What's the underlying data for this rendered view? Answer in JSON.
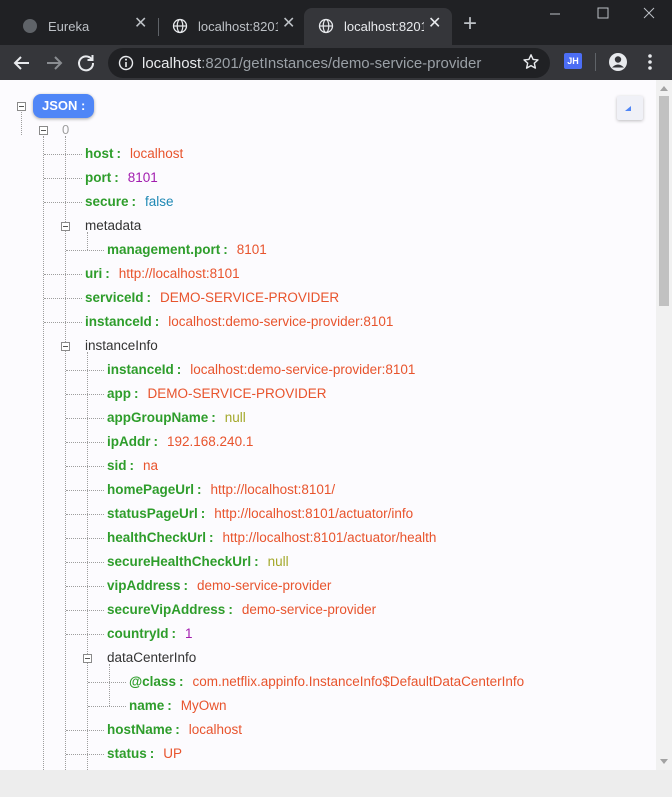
{
  "tabs": [
    {
      "title": "Eureka",
      "active": false,
      "icon": "globe-icon"
    },
    {
      "title": "localhost:8201",
      "active": false,
      "icon": "globe-icon"
    },
    {
      "title": "localhost:8201",
      "active": true,
      "icon": "globe-icon"
    }
  ],
  "toolbar": {
    "url_host": "localhost",
    "url_rest": ":8201/getInstances/demo-service-provider",
    "extension_label": "JH"
  },
  "json_view": {
    "root_label": "JSON :",
    "index_label": "0",
    "separator": ":",
    "rows": [
      {
        "key": "host",
        "value": "localhost",
        "type": "string"
      },
      {
        "key": "port",
        "value": "8101",
        "type": "number"
      },
      {
        "key": "secure",
        "value": "false",
        "type": "bool"
      },
      {
        "key": "metadata",
        "value": "",
        "type": "object"
      },
      {
        "key": "management.port",
        "value": "8101",
        "type": "string"
      },
      {
        "key": "uri",
        "value": "http://localhost:8101",
        "type": "string"
      },
      {
        "key": "serviceId",
        "value": "DEMO-SERVICE-PROVIDER",
        "type": "string"
      },
      {
        "key": "instanceId",
        "value": "localhost:demo-service-provider:8101",
        "type": "string"
      },
      {
        "key": "instanceInfo",
        "value": "",
        "type": "object"
      },
      {
        "key": "instanceId",
        "value": "localhost:demo-service-provider:8101",
        "type": "string"
      },
      {
        "key": "app",
        "value": "DEMO-SERVICE-PROVIDER",
        "type": "string"
      },
      {
        "key": "appGroupName",
        "value": "null",
        "type": "null"
      },
      {
        "key": "ipAddr",
        "value": "192.168.240.1",
        "type": "string"
      },
      {
        "key": "sid",
        "value": "na",
        "type": "string"
      },
      {
        "key": "homePageUrl",
        "value": "http://localhost:8101/",
        "type": "string"
      },
      {
        "key": "statusPageUrl",
        "value": "http://localhost:8101/actuator/info",
        "type": "string"
      },
      {
        "key": "healthCheckUrl",
        "value": "http://localhost:8101/actuator/health",
        "type": "string"
      },
      {
        "key": "secureHealthCheckUrl",
        "value": "null",
        "type": "null"
      },
      {
        "key": "vipAddress",
        "value": "demo-service-provider",
        "type": "string"
      },
      {
        "key": "secureVipAddress",
        "value": "demo-service-provider",
        "type": "string"
      },
      {
        "key": "countryId",
        "value": "1",
        "type": "number"
      },
      {
        "key": "dataCenterInfo",
        "value": "",
        "type": "object"
      },
      {
        "key": "@class",
        "value": "com.netflix.appinfo.InstanceInfo$DefaultDataCenterInfo",
        "type": "string"
      },
      {
        "key": "name",
        "value": "MyOwn",
        "type": "string"
      },
      {
        "key": "hostName",
        "value": "localhost",
        "type": "string"
      },
      {
        "key": "status",
        "value": "UP",
        "type": "string"
      }
    ]
  },
  "colors": {
    "key": "#2e9d2b",
    "string": "#e8542d",
    "number": "#a21caf",
    "bool": "#1e88b4",
    "null": "#a3a82a",
    "root_badge": "#4f86f7"
  }
}
